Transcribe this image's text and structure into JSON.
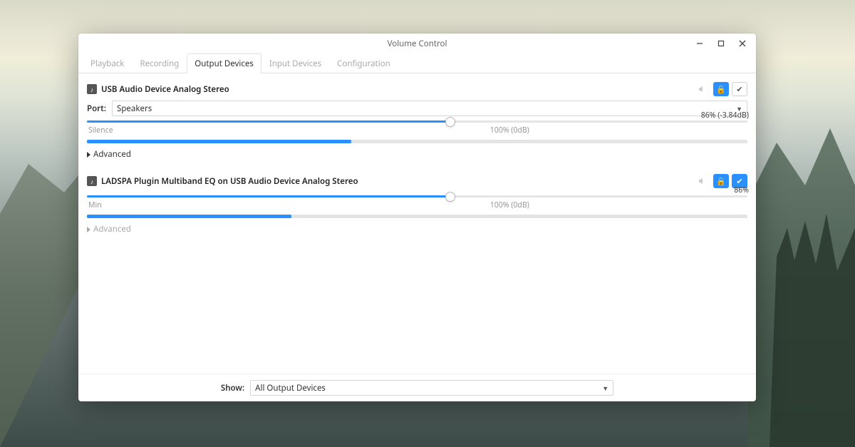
{
  "window": {
    "title": "Volume Control"
  },
  "tabs": [
    {
      "label": "Playback",
      "active": false
    },
    {
      "label": "Recording",
      "active": false
    },
    {
      "label": "Output Devices",
      "active": true
    },
    {
      "label": "Input Devices",
      "active": false
    },
    {
      "label": "Configuration",
      "active": false
    }
  ],
  "devices": [
    {
      "id": "usb-audio",
      "name": "USB Audio Device Analog Stereo",
      "has_port": true,
      "port_label": "Port:",
      "port_value": "Speakers",
      "slider_min_label": "Silence",
      "slider_100_label": "100% (0dB)",
      "slider_percent": 55,
      "hundred_pos_percent": 64,
      "value_text": "86% (-3.84dB)",
      "vu_percent": 40,
      "advanced_label": "Advanced",
      "advanced_dim": false,
      "default_active": false
    },
    {
      "id": "ladspa-eq",
      "name": "LADSPA Plugin Multiband EQ on USB Audio Device Analog Stereo",
      "has_port": false,
      "slider_min_label": "Min",
      "slider_100_label": "100% (0dB)",
      "slider_percent": 55,
      "hundred_pos_percent": 64,
      "value_text": "86%",
      "vu_percent": 31,
      "advanced_label": "Advanced",
      "advanced_dim": true,
      "default_active": true
    }
  ],
  "footer": {
    "show_label": "Show:",
    "show_value": "All Output Devices"
  },
  "icons": {
    "lock": "🔒",
    "check": "✔",
    "mute": "🔇"
  }
}
